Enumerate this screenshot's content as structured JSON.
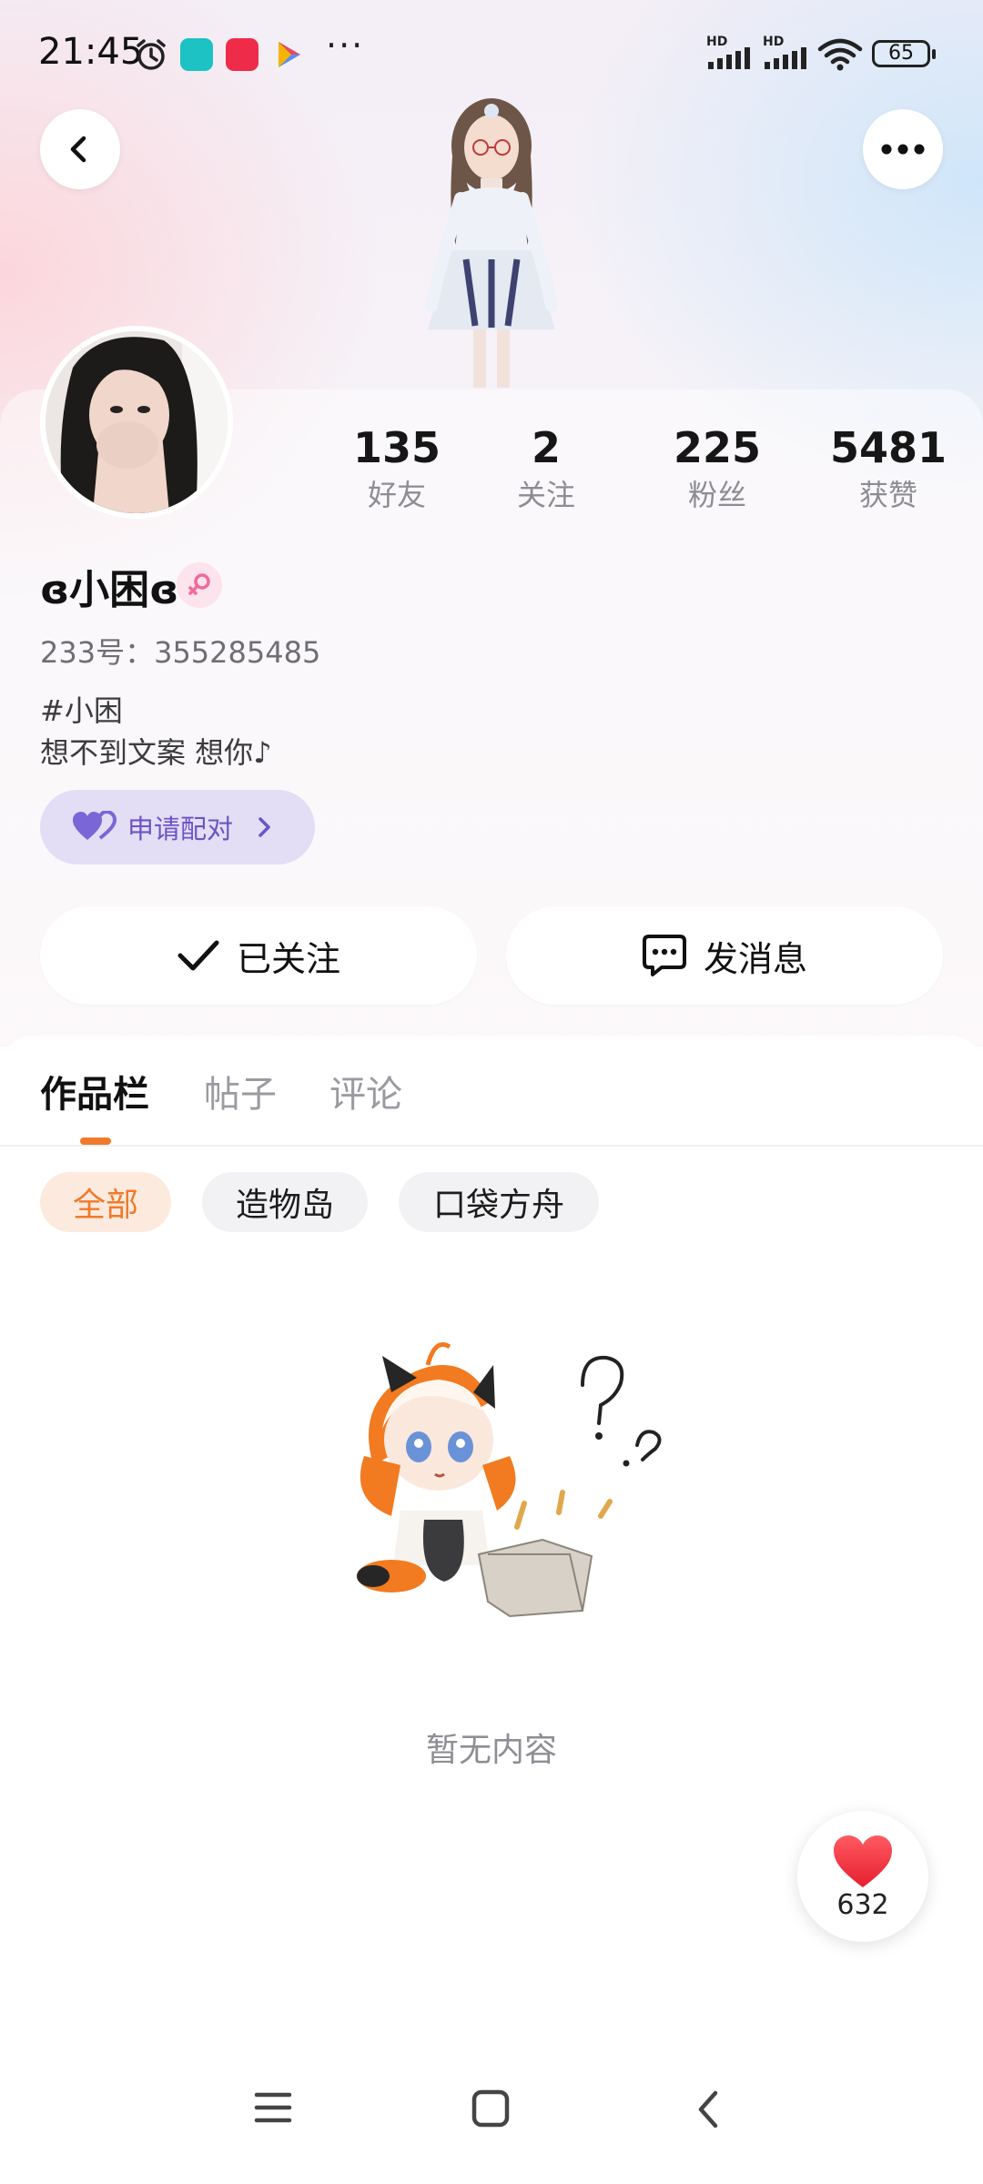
{
  "status_bar": {
    "time": "21:45",
    "more": "···",
    "battery": "65",
    "network_labels": [
      "HD",
      "HD"
    ],
    "icons": [
      "alarm-icon",
      "app-home-icon",
      "app-red-icon",
      "play-store-icon",
      "signal-icon",
      "signal-icon",
      "wifi-icon",
      "battery-icon"
    ]
  },
  "header": {
    "back_icon": "chevron-left-icon",
    "more_icon": "more-dots-icon"
  },
  "profile": {
    "nickname": "ɞ小困ɞ",
    "gender_icon": "female-icon",
    "uid": "233号：355285485",
    "bio_line1": "#小困",
    "bio_line2": "想不到文案  想你♪",
    "match_button": "申请配对",
    "stats": [
      {
        "value": "135",
        "label": "好友"
      },
      {
        "value": "2",
        "label": "关注"
      },
      {
        "value": "225",
        "label": "粉丝"
      },
      {
        "value": "5481",
        "label": "获赞"
      }
    ]
  },
  "actions": {
    "follow_label": "已关注",
    "message_label": "发消息"
  },
  "tabs": [
    "作品栏",
    "帖子",
    "评论"
  ],
  "filters": [
    "全部",
    "造物岛",
    "口袋方舟"
  ],
  "empty_state": "暂无内容",
  "like_float": {
    "count": "632"
  },
  "colors": {
    "accent_orange": "#f07a2b",
    "match_purple": "#6a55c4",
    "heart_red": "#f5333f"
  }
}
